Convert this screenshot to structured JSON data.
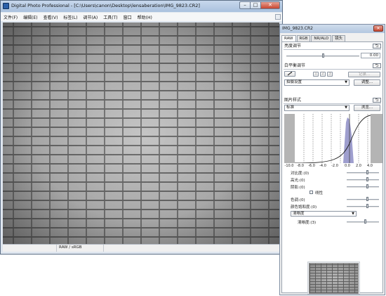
{
  "main_window": {
    "title": "Digital Photo Professional - [C:\\Users\\canon\\Desktop\\lensaberation\\IMG_9823.CR2]",
    "menu": [
      "文件(F)",
      "编辑(E)",
      "查看(V)",
      "标签(L)",
      "调节(A)",
      "工具(T)",
      "窗口",
      "帮助(H)"
    ],
    "buttons": {
      "minimize": "–",
      "maximize": "□",
      "close": "✕"
    },
    "status": [
      "",
      "RAW / sRGB"
    ]
  },
  "tool_palette": {
    "title": "IMG_9823.CR2",
    "close": "✕",
    "tabs": [
      "RAW",
      "RGB",
      "NR/ALO",
      "镜头"
    ],
    "reset_glyph": "⮌",
    "brightness": {
      "label": "亮度调节",
      "value": "0.00",
      "level": 0.0
    },
    "white_balance": {
      "label": "白平衡调节",
      "eyedropper_icon": "eyedropper-icon",
      "presets": [
        "1",
        "2",
        "3"
      ],
      "register_label": "记录...",
      "mode": "拍摄设置",
      "adjust_label": "调整..."
    },
    "picture_style": {
      "label": "图片样式",
      "style": "标准",
      "browse_label": "浏览...",
      "axis_ticks": [
        "-10.0",
        "-8.0",
        "-6.0",
        "-4.0",
        "-2.0",
        "0.0",
        "2.0",
        "4.0"
      ],
      "contrast": {
        "label": "对比度:(0)",
        "level": 0
      },
      "highlight": {
        "label": "高光:(0)",
        "level": 0
      },
      "shadow": {
        "label": "阴影:(0)",
        "level": 0
      },
      "linear_label": "线性",
      "linear_checked": false,
      "tone": {
        "label": "色调:(0)",
        "level": 0
      },
      "saturation": {
        "label": "颜色饱和度:(0)",
        "level": 0
      },
      "sharpness_mode": "清晰度",
      "sharpness": {
        "label": "清晰度:(3)",
        "level": 3
      }
    }
  }
}
